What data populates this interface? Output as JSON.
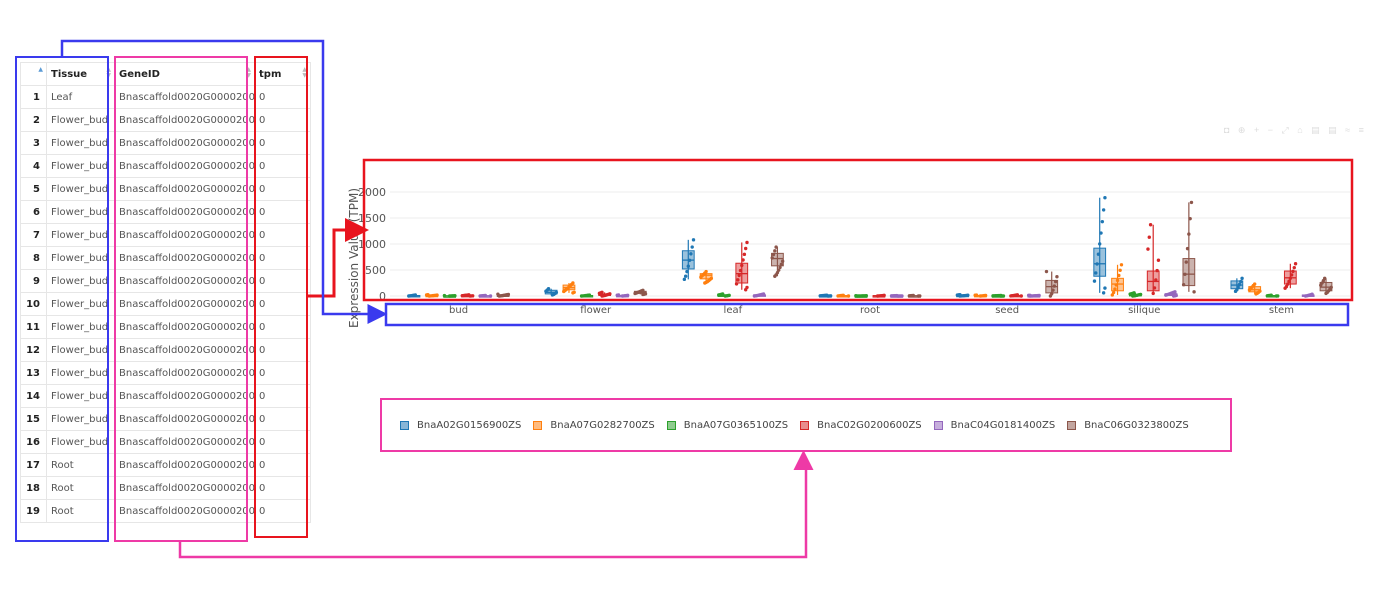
{
  "table": {
    "columns": [
      "Tissue",
      "GeneID",
      "tpm"
    ],
    "rows": [
      {
        "index": "1",
        "tissue": "Leaf",
        "gene": "Bnascaffold0020G0000200ZS",
        "tpm": "0"
      },
      {
        "index": "2",
        "tissue": "Flower_bud",
        "gene": "Bnascaffold0020G0000200ZS",
        "tpm": "0"
      },
      {
        "index": "3",
        "tissue": "Flower_bud",
        "gene": "Bnascaffold0020G0000200ZS",
        "tpm": "0"
      },
      {
        "index": "4",
        "tissue": "Flower_bud",
        "gene": "Bnascaffold0020G0000200ZS",
        "tpm": "0"
      },
      {
        "index": "5",
        "tissue": "Flower_bud",
        "gene": "Bnascaffold0020G0000200ZS",
        "tpm": "0"
      },
      {
        "index": "6",
        "tissue": "Flower_bud",
        "gene": "Bnascaffold0020G0000200ZS",
        "tpm": "0"
      },
      {
        "index": "7",
        "tissue": "Flower_bud",
        "gene": "Bnascaffold0020G0000200ZS",
        "tpm": "0"
      },
      {
        "index": "8",
        "tissue": "Flower_bud",
        "gene": "Bnascaffold0020G0000200ZS",
        "tpm": "0"
      },
      {
        "index": "9",
        "tissue": "Flower_bud",
        "gene": "Bnascaffold0020G0000200ZS",
        "tpm": "0"
      },
      {
        "index": "10",
        "tissue": "Flower_bud",
        "gene": "Bnascaffold0020G0000200ZS",
        "tpm": "0"
      },
      {
        "index": "11",
        "tissue": "Flower_bud",
        "gene": "Bnascaffold0020G0000200ZS",
        "tpm": "0"
      },
      {
        "index": "12",
        "tissue": "Flower_bud",
        "gene": "Bnascaffold0020G0000200ZS",
        "tpm": "0"
      },
      {
        "index": "13",
        "tissue": "Flower_bud",
        "gene": "Bnascaffold0020G0000200ZS",
        "tpm": "0"
      },
      {
        "index": "14",
        "tissue": "Flower_bud",
        "gene": "Bnascaffold0020G0000200ZS",
        "tpm": "0"
      },
      {
        "index": "15",
        "tissue": "Flower_bud",
        "gene": "Bnascaffold0020G0000200ZS",
        "tpm": "0"
      },
      {
        "index": "16",
        "tissue": "Flower_bud",
        "gene": "Bnascaffold0020G0000200ZS",
        "tpm": "0"
      },
      {
        "index": "17",
        "tissue": "Root",
        "gene": "Bnascaffold0020G0000200ZS",
        "tpm": "0"
      },
      {
        "index": "18",
        "tissue": "Root",
        "gene": "Bnascaffold0020G0000200ZS",
        "tpm": "0"
      },
      {
        "index": "19",
        "tissue": "Root",
        "gene": "Bnascaffold0020G0000200ZS",
        "tpm": "0"
      }
    ]
  },
  "colors": {
    "blue_frame": "#3a3aee",
    "pink_frame": "#ee3aa6",
    "red_frame": "#e8141e"
  },
  "chart_data": {
    "type": "box",
    "ylabel": "Expression Value (TPM)",
    "ylim": [
      0,
      2200
    ],
    "yticks": [
      0,
      500,
      1000,
      1500,
      2000
    ],
    "categories": [
      "bud",
      "flower",
      "leaf",
      "root",
      "seed",
      "silique",
      "stem"
    ],
    "grid": true,
    "legend_position": "bottom",
    "series": [
      {
        "name": "BnaA02G0156900ZS",
        "color": "#1f77b4",
        "boxes": [
          [
            0,
            2,
            5,
            10,
            20
          ],
          [
            20,
            40,
            70,
            110,
            140
          ],
          [
            320,
            520,
            690,
            870,
            1080
          ],
          [
            0,
            2,
            4,
            8,
            15
          ],
          [
            0,
            3,
            8,
            15,
            25
          ],
          [
            60,
            380,
            620,
            920,
            1890
          ],
          [
            90,
            140,
            210,
            290,
            340
          ]
        ]
      },
      {
        "name": "BnaA07G0282700ZS",
        "color": "#ff7f0e",
        "boxes": [
          [
            0,
            3,
            8,
            14,
            25
          ],
          [
            60,
            120,
            160,
            210,
            250
          ],
          [
            250,
            330,
            400,
            430,
            470
          ],
          [
            0,
            2,
            5,
            9,
            14
          ],
          [
            0,
            3,
            7,
            12,
            18
          ],
          [
            20,
            100,
            230,
            340,
            600
          ],
          [
            40,
            80,
            120,
            180,
            230
          ]
        ]
      },
      {
        "name": "BnaA07G0365100ZS",
        "color": "#2ca02c",
        "boxes": [
          [
            0,
            1,
            2,
            4,
            8
          ],
          [
            0,
            3,
            6,
            10,
            18
          ],
          [
            0,
            5,
            10,
            20,
            40
          ],
          [
            0,
            1,
            2,
            3,
            6
          ],
          [
            0,
            1,
            3,
            6,
            10
          ],
          [
            0,
            5,
            15,
            30,
            60
          ],
          [
            0,
            2,
            5,
            9,
            15
          ]
        ]
      },
      {
        "name": "BnaC02G0200600ZS",
        "color": "#d62728",
        "boxes": [
          [
            0,
            2,
            6,
            12,
            22
          ],
          [
            0,
            10,
            20,
            40,
            70
          ],
          [
            120,
            250,
            430,
            630,
            1030
          ],
          [
            0,
            2,
            4,
            8,
            12
          ],
          [
            0,
            2,
            6,
            12,
            22
          ],
          [
            50,
            100,
            280,
            480,
            1370
          ],
          [
            150,
            230,
            350,
            480,
            620
          ]
        ]
      },
      {
        "name": "BnaC04G0181400ZS",
        "color": "#9467bd",
        "boxes": [
          [
            0,
            1,
            3,
            6,
            10
          ],
          [
            0,
            3,
            7,
            12,
            20
          ],
          [
            0,
            5,
            12,
            22,
            40
          ],
          [
            0,
            1,
            2,
            4,
            7
          ],
          [
            0,
            2,
            4,
            8,
            14
          ],
          [
            0,
            10,
            25,
            45,
            80
          ],
          [
            0,
            5,
            12,
            20,
            35
          ]
        ]
      },
      {
        "name": "BnaC06G0323800ZS",
        "color": "#8c564b",
        "boxes": [
          [
            0,
            3,
            10,
            20,
            35
          ],
          [
            30,
            50,
            70,
            90,
            110
          ],
          [
            380,
            580,
            720,
            820,
            940
          ],
          [
            0,
            1,
            3,
            6,
            10
          ],
          [
            0,
            60,
            180,
            300,
            470
          ],
          [
            80,
            200,
            420,
            720,
            1800
          ],
          [
            50,
            100,
            170,
            260,
            340
          ]
        ]
      }
    ]
  },
  "legend": {
    "items": [
      {
        "name": "BnaA02G0156900ZS",
        "color": "#1f77b4"
      },
      {
        "name": "BnaA07G0282700ZS",
        "color": "#ff7f0e"
      },
      {
        "name": "BnaA07G0365100ZS",
        "color": "#2ca02c"
      },
      {
        "name": "BnaC02G0200600ZS",
        "color": "#d62728"
      },
      {
        "name": "BnaC04G0181400ZS",
        "color": "#9467bd"
      },
      {
        "name": "BnaC06G0323800ZS",
        "color": "#8c564b"
      }
    ]
  }
}
